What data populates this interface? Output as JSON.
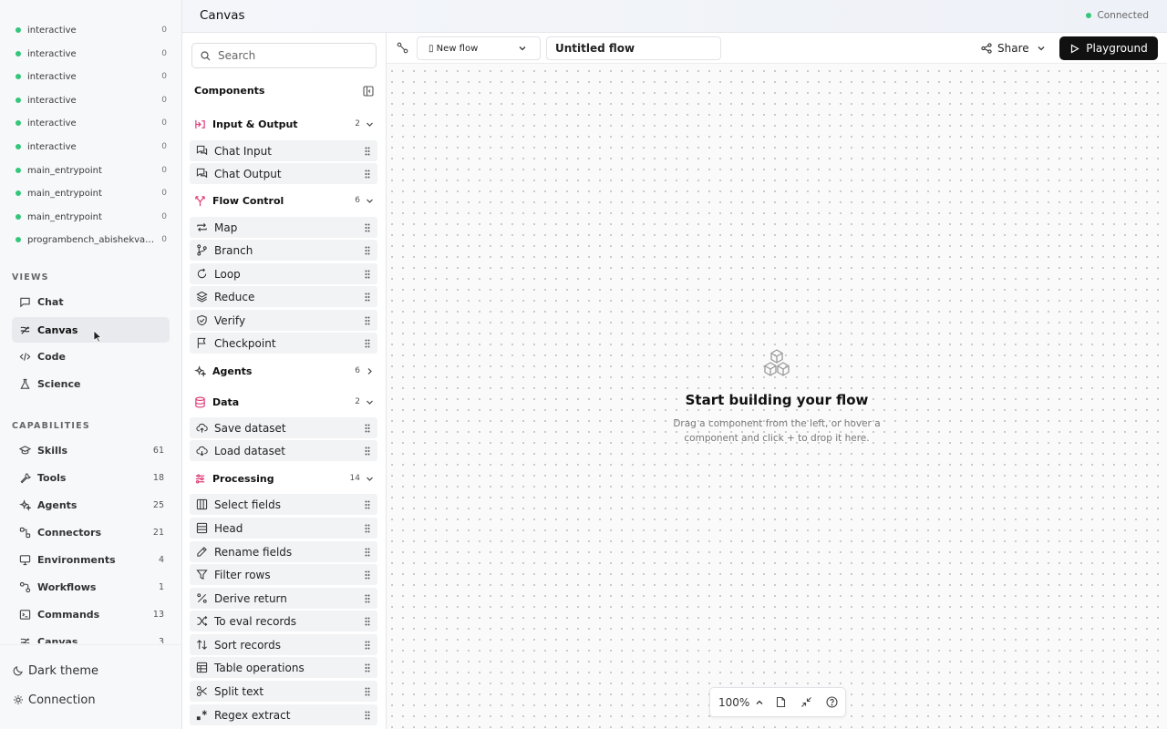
{
  "sidebar": {
    "sessions": [
      {
        "name": "interactive",
        "count": "0"
      },
      {
        "name": "interactive",
        "count": "0"
      },
      {
        "name": "interactive",
        "count": "0"
      },
      {
        "name": "interactive",
        "count": "0"
      },
      {
        "name": "interactive",
        "count": "0"
      },
      {
        "name": "interactive",
        "count": "0"
      },
      {
        "name": "main_entrypoint",
        "count": "0"
      },
      {
        "name": "main_entrypoint",
        "count": "0"
      },
      {
        "name": "main_entrypoint",
        "count": "0"
      },
      {
        "name": "programbench_abishekvas...",
        "count": "0"
      }
    ],
    "views_label": "VIEWS",
    "views": [
      {
        "label": "Chat",
        "icon": "chat-icon"
      },
      {
        "label": "Canvas",
        "icon": "canvas-icon",
        "active": true
      },
      {
        "label": "Code",
        "icon": "code-icon"
      },
      {
        "label": "Science",
        "icon": "flask-icon"
      }
    ],
    "capabilities_label": "CAPABILITIES",
    "capabilities": [
      {
        "label": "Skills",
        "count": "61",
        "icon": "graduation-cap-icon"
      },
      {
        "label": "Tools",
        "count": "18",
        "icon": "wrench-icon"
      },
      {
        "label": "Agents",
        "count": "25",
        "icon": "sparkles-icon"
      },
      {
        "label": "Connectors",
        "count": "21",
        "icon": "connectors-icon"
      },
      {
        "label": "Environments",
        "count": "4",
        "icon": "monitor-icon"
      },
      {
        "label": "Workflows",
        "count": "1",
        "icon": "workflow-icon"
      },
      {
        "label": "Commands",
        "count": "13",
        "icon": "terminal-icon"
      },
      {
        "label": "Canvas",
        "count": "3",
        "icon": "canvas-icon"
      }
    ],
    "bottom": {
      "theme_label": "Dark theme",
      "connection_label": "Connection"
    }
  },
  "header": {
    "title": "Canvas",
    "status": "Connected",
    "status_color": "#34c77b"
  },
  "components_panel": {
    "search_placeholder": "Search",
    "title": "Components",
    "categories": [
      {
        "label": "Input & Output",
        "count": "2",
        "icon_color": "#e0407a",
        "items": [
          "Chat Input",
          "Chat Output"
        ]
      },
      {
        "label": "Flow Control",
        "count": "6",
        "icon_color": "#e0407a",
        "items": [
          "Map",
          "Branch",
          "Loop",
          "Reduce",
          "Verify",
          "Checkpoint"
        ]
      },
      {
        "label": "Agents",
        "count": "6",
        "collapsed": true
      },
      {
        "label": "Data",
        "count": "2",
        "icon_color": "#e0407a",
        "items": [
          "Save dataset",
          "Load dataset"
        ]
      },
      {
        "label": "Processing",
        "count": "14",
        "icon_color": "#e0407a",
        "items": [
          "Select fields",
          "Head",
          "Rename fields",
          "Filter rows",
          "Derive return",
          "To eval records",
          "Sort records",
          "Table operations",
          "Split text",
          "Regex extract"
        ]
      }
    ]
  },
  "toolbar": {
    "flow_select": "▯ New flow",
    "flow_name": "Untitled flow",
    "share_label": "Share",
    "playground_label": "Playground"
  },
  "canvas": {
    "empty_title": "Start building your flow",
    "empty_desc": "Drag a component from the left, or hover a component and click + to drop it here.",
    "zoom": "100%"
  }
}
